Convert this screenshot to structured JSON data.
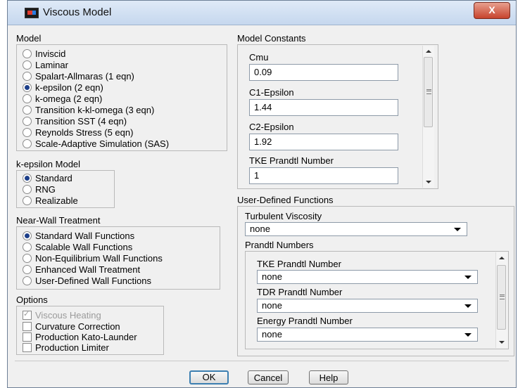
{
  "window": {
    "title": "Viscous Model",
    "close_glyph": "X"
  },
  "model": {
    "heading": "Model",
    "options": [
      "Inviscid",
      "Laminar",
      "Spalart-Allmaras (1 eqn)",
      "k-epsilon (2 eqn)",
      "k-omega (2 eqn)",
      "Transition k-kl-omega (3 eqn)",
      "Transition SST (4 eqn)",
      "Reynolds Stress (5 eqn)",
      "Scale-Adaptive Simulation (SAS)"
    ],
    "selected": "k-epsilon (2 eqn)"
  },
  "ke_model": {
    "heading": "k-epsilon Model",
    "options": [
      "Standard",
      "RNG",
      "Realizable"
    ],
    "selected": "Standard"
  },
  "near_wall": {
    "heading": "Near-Wall Treatment",
    "options": [
      "Standard Wall Functions",
      "Scalable Wall Functions",
      "Non-Equilibrium Wall Functions",
      "Enhanced Wall Treatment",
      "User-Defined Wall Functions"
    ],
    "selected": "Standard Wall Functions"
  },
  "options": {
    "heading": "Options",
    "items": [
      {
        "label": "Viscous Heating",
        "checked": true,
        "disabled": true
      },
      {
        "label": "Curvature Correction",
        "checked": false,
        "disabled": false
      },
      {
        "label": "Production Kato-Launder",
        "checked": false,
        "disabled": false
      },
      {
        "label": "Production Limiter",
        "checked": false,
        "disabled": false
      }
    ]
  },
  "constants": {
    "heading": "Model Constants",
    "fields": [
      {
        "label": "Cmu",
        "value": "0.09"
      },
      {
        "label": "C1-Epsilon",
        "value": "1.44"
      },
      {
        "label": "C2-Epsilon",
        "value": "1.92"
      },
      {
        "label": "TKE Prandtl Number",
        "value": "1"
      }
    ]
  },
  "udf": {
    "heading": "User-Defined Functions",
    "turbulent_viscosity_label": "Turbulent Viscosity",
    "turbulent_viscosity_value": "none",
    "prandtl_heading": "Prandtl Numbers",
    "prandtl": [
      {
        "label": "TKE Prandtl Number",
        "value": "none"
      },
      {
        "label": "TDR Prandtl Number",
        "value": "none"
      },
      {
        "label": "Energy Prandtl Number",
        "value": "none"
      }
    ]
  },
  "buttons": {
    "ok": "OK",
    "cancel": "Cancel",
    "help": "Help"
  }
}
